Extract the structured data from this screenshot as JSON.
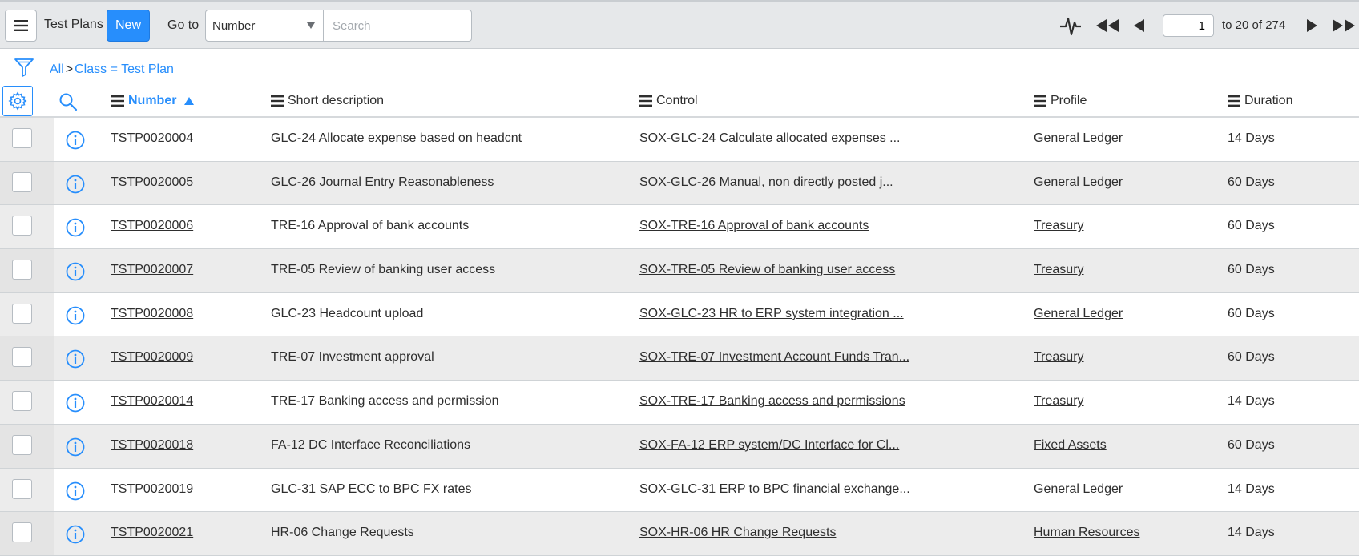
{
  "toolbar": {
    "title": "Test Plans",
    "new_label": "New",
    "goto_label": "Go to",
    "goto_selected": "Number",
    "search_placeholder": "Search",
    "page_value": "1",
    "page_range": "to 20 of 274"
  },
  "breadcrumb": {
    "all": "All",
    "separator": ">",
    "condition": "Class = Test Plan"
  },
  "columns": {
    "number": "Number",
    "short_description": "Short description",
    "control": "Control",
    "profile": "Profile",
    "duration": "Duration"
  },
  "colors": {
    "accent": "#278efc",
    "toolbar_bg": "#e6e8ea",
    "row_alt": "#ececec"
  },
  "rows": [
    {
      "number": "TSTP0020004",
      "desc": "GLC-24 Allocate expense based on headcnt",
      "control": "SOX-GLC-24 Calculate allocated expenses ...",
      "profile": "General Ledger",
      "duration": "14 Days"
    },
    {
      "number": "TSTP0020005",
      "desc": "GLC-26 Journal Entry Reasonableness",
      "control": "SOX-GLC-26 Manual, non directly posted j...",
      "profile": "General Ledger",
      "duration": "60 Days"
    },
    {
      "number": "TSTP0020006",
      "desc": "TRE-16 Approval of bank accounts",
      "control": "SOX-TRE-16 Approval of bank accounts",
      "profile": "Treasury",
      "duration": "60 Days"
    },
    {
      "number": "TSTP0020007",
      "desc": "TRE-05 Review of banking user access",
      "control": "SOX-TRE-05 Review of banking user access",
      "profile": "Treasury",
      "duration": "60 Days"
    },
    {
      "number": "TSTP0020008",
      "desc": "GLC-23 Headcount upload",
      "control": "SOX-GLC-23 HR to ERP system integration ...",
      "profile": "General Ledger",
      "duration": "60 Days"
    },
    {
      "number": "TSTP0020009",
      "desc": "TRE-07 Investment approval",
      "control": "SOX-TRE-07 Investment Account Funds Tran...",
      "profile": "Treasury",
      "duration": "60 Days"
    },
    {
      "number": "TSTP0020014",
      "desc": "TRE-17 Banking access and permission",
      "control": "SOX-TRE-17 Banking access and permissions",
      "profile": "Treasury",
      "duration": "14 Days"
    },
    {
      "number": "TSTP0020018",
      "desc": "FA-12 DC Interface Reconciliations",
      "control": "SOX-FA-12 ERP system/DC Interface for Cl...",
      "profile": "Fixed Assets",
      "duration": "60 Days"
    },
    {
      "number": "TSTP0020019",
      "desc": "GLC-31 SAP ECC to BPC FX rates",
      "control": "SOX-GLC-31 ERP to BPC financial exchange...",
      "profile": "General Ledger",
      "duration": "14 Days"
    },
    {
      "number": "TSTP0020021",
      "desc": "HR-06 Change Requests",
      "control": "SOX-HR-06 HR Change Requests",
      "profile": "Human Resources",
      "duration": "14 Days"
    }
  ]
}
